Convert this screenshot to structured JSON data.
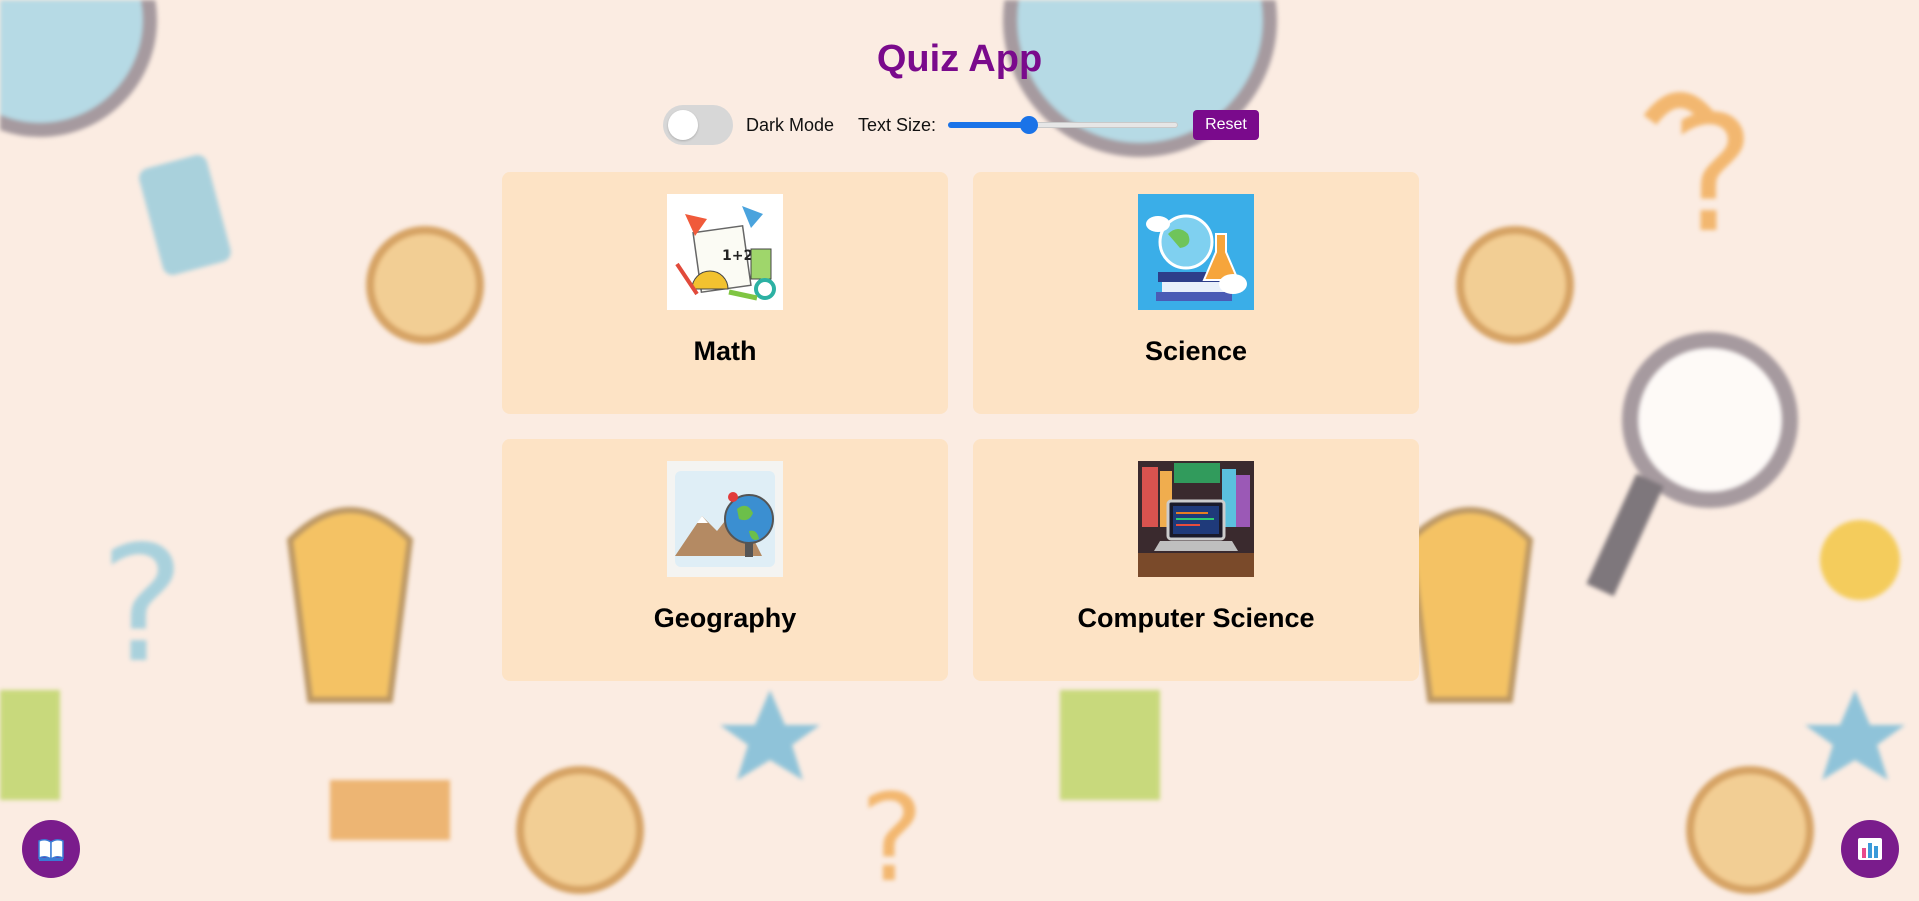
{
  "app": {
    "title": "Quiz App"
  },
  "controls": {
    "dark_mode_label": "Dark Mode",
    "dark_mode_on": false,
    "text_size_label": "Text Size:",
    "text_size_fraction": 0.35,
    "reset_label": "Reset"
  },
  "categories": [
    {
      "name": "Math",
      "icon": "math-tools-icon"
    },
    {
      "name": "Science",
      "icon": "science-lab-icon"
    },
    {
      "name": "Geography",
      "icon": "globe-mountains-icon"
    },
    {
      "name": "Computer Science",
      "icon": "laptop-books-icon"
    }
  ],
  "fab": {
    "left_icon": "book-icon",
    "right_icon": "bar-chart-icon"
  },
  "colors": {
    "accent": "#7a0a8c",
    "card_bg": "#fde3c5",
    "page_bg": "#fbece2",
    "slider": "#1a73e8"
  }
}
